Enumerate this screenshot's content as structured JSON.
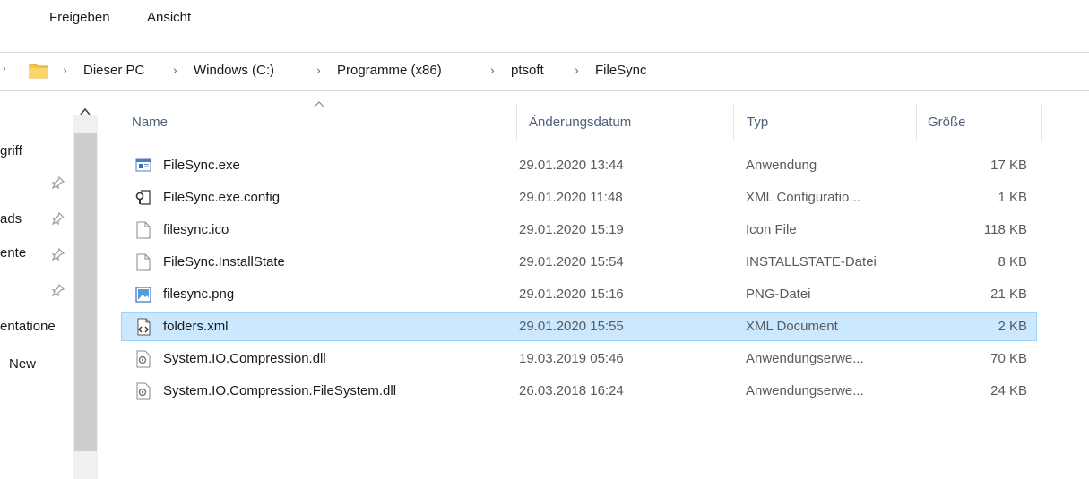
{
  "ribbon": {
    "tabs": [
      "Freigeben",
      "Ansicht"
    ]
  },
  "breadcrumb": [
    "Dieser PC",
    "Windows (C:)",
    "Programme (x86)",
    "ptsoft",
    "FileSync"
  ],
  "nav": {
    "items": [
      {
        "label": "griff",
        "pinned": false
      },
      {
        "label": "",
        "pinned": true
      },
      {
        "label": "ads",
        "pinned": true
      },
      {
        "label": "ente",
        "pinned": true
      },
      {
        "label": "",
        "pinned": true
      },
      {
        "label": "entatione",
        "pinned": false
      },
      {
        "label": "New",
        "pinned": false
      }
    ]
  },
  "columns": {
    "name": "Name",
    "date": "Änderungsdatum",
    "type": "Typ",
    "size": "Größe"
  },
  "files": [
    {
      "icon": "exe-icon",
      "name": "FileSync.exe",
      "date": "29.01.2020 13:44",
      "type": "Anwendung",
      "size": "17 KB",
      "selected": false
    },
    {
      "icon": "config-icon",
      "name": "FileSync.exe.config",
      "date": "29.01.2020 11:48",
      "type": "XML Configuratio...",
      "size": "1 KB",
      "selected": false
    },
    {
      "icon": "file-icon",
      "name": "filesync.ico",
      "date": "29.01.2020 15:19",
      "type": "Icon File",
      "size": "118 KB",
      "selected": false
    },
    {
      "icon": "file-icon",
      "name": "FileSync.InstallState",
      "date": "29.01.2020 15:54",
      "type": "INSTALLSTATE-Datei",
      "size": "8 KB",
      "selected": false
    },
    {
      "icon": "image-icon",
      "name": "filesync.png",
      "date": "29.01.2020 15:16",
      "type": "PNG-Datei",
      "size": "21 KB",
      "selected": false
    },
    {
      "icon": "xml-icon",
      "name": "folders.xml",
      "date": "29.01.2020 15:55",
      "type": "XML Document",
      "size": "2 KB",
      "selected": true
    },
    {
      "icon": "dll-icon",
      "name": "System.IO.Compression.dll",
      "date": "19.03.2019 05:46",
      "type": "Anwendungserwe...",
      "size": "70 KB",
      "selected": false
    },
    {
      "icon": "dll-icon",
      "name": "System.IO.Compression.FileSystem.dll",
      "date": "26.03.2018 16:24",
      "type": "Anwendungserwe...",
      "size": "24 KB",
      "selected": false
    }
  ],
  "colors": {
    "selection": "#cce8ff",
    "selection_border": "#99d1ff",
    "folder": "#f4c54a",
    "header_text": "#4c607a"
  }
}
